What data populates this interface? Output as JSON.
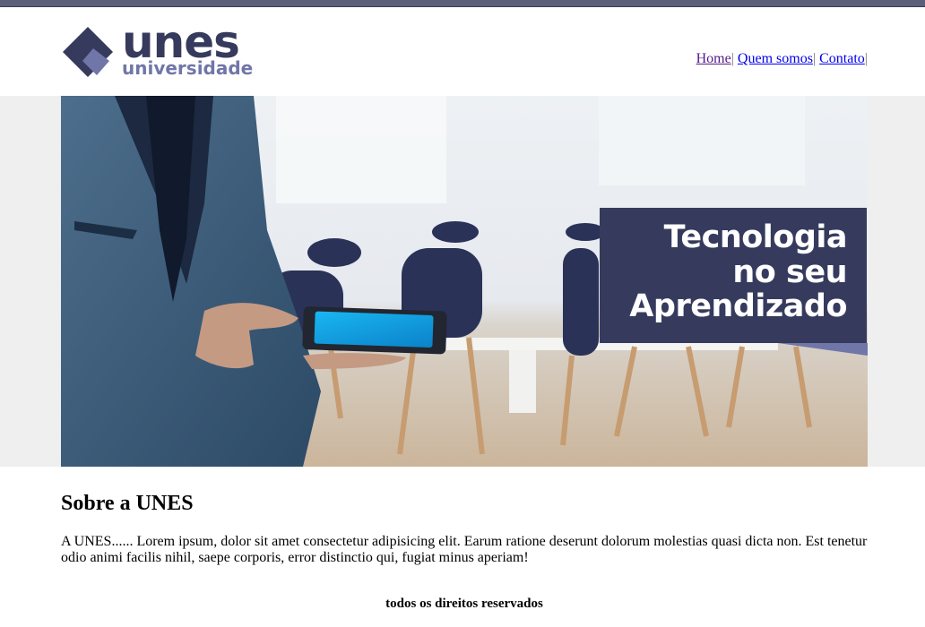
{
  "brand": {
    "name": "unes",
    "tagline": "universidade",
    "colors": {
      "primary": "#363a5c",
      "secondary": "#7176a8",
      "topbar": "#5b5f7a"
    }
  },
  "nav": {
    "items": [
      {
        "label": "Home",
        "sep": "|",
        "visited": true
      },
      {
        "label": "Quem somos",
        "sep": "|",
        "visited": false
      },
      {
        "label": "Contato",
        "sep": "|",
        "visited": false
      }
    ]
  },
  "banner": {
    "caption_lines": [
      "Tecnologia",
      "no seu",
      "Aprendizado"
    ],
    "caption_bg": "#363b5e",
    "image_desc_icon": "man-with-tablet-photo"
  },
  "about": {
    "title": "Sobre a UNES",
    "body": "A UNES...... Lorem ipsum, dolor sit amet consectetur adipisicing elit. Earum ratione deserunt dolorum molestias quasi dicta non. Est tenetur odio animi facilis nihil, saepe corporis, error distinctio qui, fugiat minus aperiam!"
  },
  "footer": {
    "text": "todos os direitos reservados"
  }
}
